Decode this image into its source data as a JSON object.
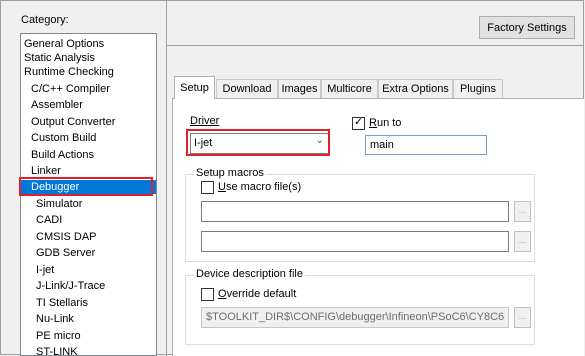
{
  "category": {
    "label": "Category:",
    "items": [
      {
        "label": "General Options",
        "level": 0
      },
      {
        "label": "Static Analysis",
        "level": 0
      },
      {
        "label": "Runtime Checking",
        "level": 0
      },
      {
        "label": "C/C++ Compiler",
        "level": 1
      },
      {
        "label": "Assembler",
        "level": 1
      },
      {
        "label": "Output Converter",
        "level": 1
      },
      {
        "label": "Custom Build",
        "level": 1
      },
      {
        "label": "Build Actions",
        "level": 1
      },
      {
        "label": "Linker",
        "level": 1
      },
      {
        "label": "Debugger",
        "level": 1
      },
      {
        "label": "Simulator",
        "level": 2
      },
      {
        "label": "CADI",
        "level": 2
      },
      {
        "label": "CMSIS DAP",
        "level": 2
      },
      {
        "label": "GDB Server",
        "level": 2
      },
      {
        "label": "I-jet",
        "level": 2
      },
      {
        "label": "J-Link/J-Trace",
        "level": 2
      },
      {
        "label": "TI Stellaris",
        "level": 2
      },
      {
        "label": "Nu-Link",
        "level": 2
      },
      {
        "label": "PE micro",
        "level": 2
      },
      {
        "label": "ST-LINK",
        "level": 2
      }
    ],
    "selected": "Debugger"
  },
  "factory_settings": "Factory Settings",
  "tabs": [
    "Setup",
    "Download",
    "Images",
    "Multicore",
    "Extra Options",
    "Plugins"
  ],
  "active_tab": "Setup",
  "driver": {
    "label": "Driver",
    "value": "I-jet"
  },
  "run_to": {
    "label": "Run to",
    "checked": true,
    "value": "main"
  },
  "setup_macros": {
    "title": "Setup macros",
    "checkbox": "Use macro file(s)",
    "checked": false
  },
  "device_description": {
    "title": "Device description file",
    "checkbox": "Override default",
    "checked": false,
    "path": "$TOOLKIT_DIR$\\CONFIG\\debugger\\Infineon\\PSoC6\\CY8C6"
  },
  "ellipsis": "..."
}
